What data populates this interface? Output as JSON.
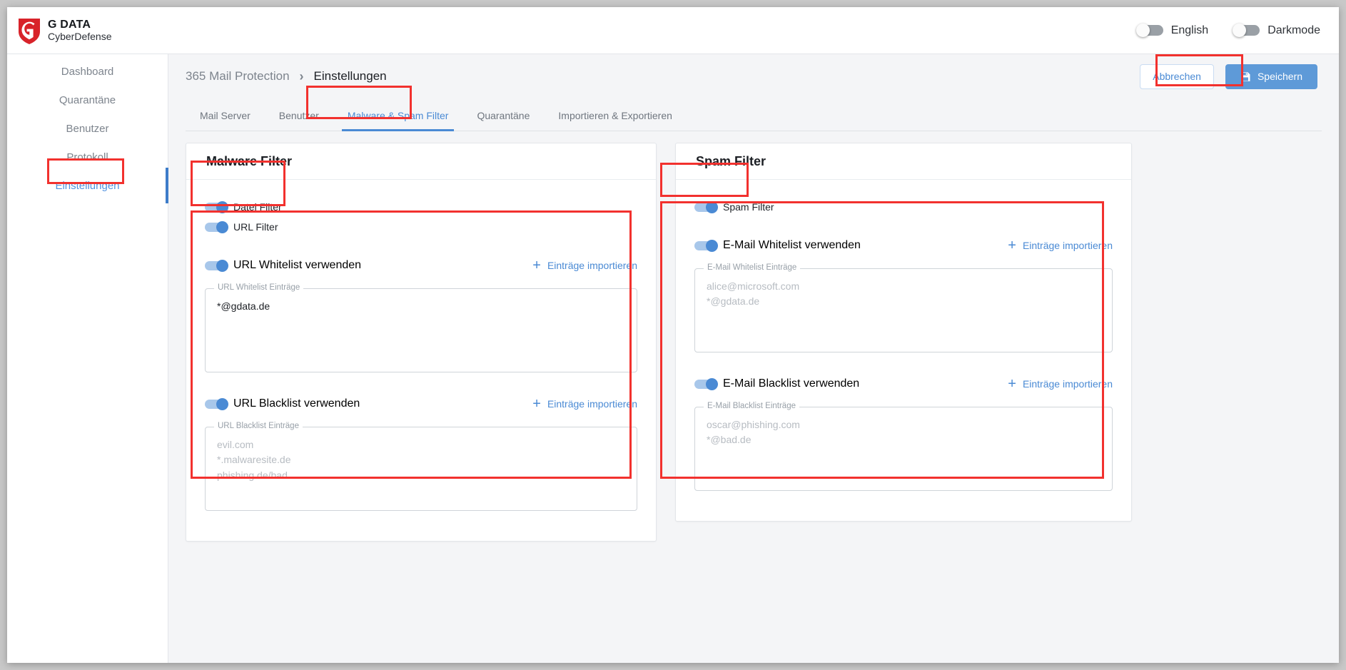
{
  "brand": {
    "title": "G DATA",
    "subtitle": "CyberDefense",
    "logo_color": "#d8232a"
  },
  "topbar": {
    "language_toggle": {
      "label": "English",
      "state": "off"
    },
    "darkmode_toggle": {
      "label": "Darkmode",
      "state": "off"
    }
  },
  "sidebar": {
    "items": [
      {
        "label": "Dashboard",
        "active": false
      },
      {
        "label": "Quarantäne",
        "active": false
      },
      {
        "label": "Benutzer",
        "active": false
      },
      {
        "label": "Protokoll",
        "active": false
      },
      {
        "label": "Einstellungen",
        "active": true
      }
    ]
  },
  "breadcrumb": {
    "root": "365 Mail Protection",
    "separator": "›",
    "current": "Einstellungen"
  },
  "actions": {
    "cancel_label": "Abbrechen",
    "save_label": "Speichern",
    "save_icon": "floppy-disk-icon"
  },
  "tabs": [
    {
      "label": "Mail Server",
      "active": false
    },
    {
      "label": "Benutzer",
      "active": false
    },
    {
      "label": "Malware & Spam Filter",
      "active": true
    },
    {
      "label": "Quarantäne",
      "active": false
    },
    {
      "label": "Importieren & Exportieren",
      "active": false
    }
  ],
  "malware_card": {
    "title": "Malware Filter",
    "toggles": [
      {
        "label": "Datei Filter",
        "state": "on"
      },
      {
        "label": "URL Filter",
        "state": "on"
      }
    ],
    "whitelist": {
      "toggle_label": "URL Whitelist verwenden",
      "toggle_state": "on",
      "import_label": "Einträge importieren",
      "field_label": "URL Whitelist Einträge",
      "value": "*@gdata.de",
      "placeholder": ""
    },
    "blacklist": {
      "toggle_label": "URL Blacklist verwenden",
      "toggle_state": "on",
      "import_label": "Einträge importieren",
      "field_label": "URL Blacklist Einträge",
      "value": "",
      "placeholder": "evil.com\n*.malwaresite.de\nphishing.de/bad"
    }
  },
  "spam_card": {
    "title": "Spam Filter",
    "toggles": [
      {
        "label": "Spam Filter",
        "state": "on"
      }
    ],
    "whitelist": {
      "toggle_label": "E-Mail Whitelist verwenden",
      "toggle_state": "on",
      "import_label": "Einträge importieren",
      "field_label": "E-Mail Whitelist Einträge",
      "value": "",
      "placeholder": "alice@microsoft.com\n*@gdata.de"
    },
    "blacklist": {
      "toggle_label": "E-Mail Blacklist verwenden",
      "toggle_state": "on",
      "import_label": "Einträge importieren",
      "field_label": "E-Mail Blacklist Einträge",
      "value": "",
      "placeholder": "oscar@phishing.com\n*@bad.de"
    }
  },
  "annotation_color": "#f2312e"
}
